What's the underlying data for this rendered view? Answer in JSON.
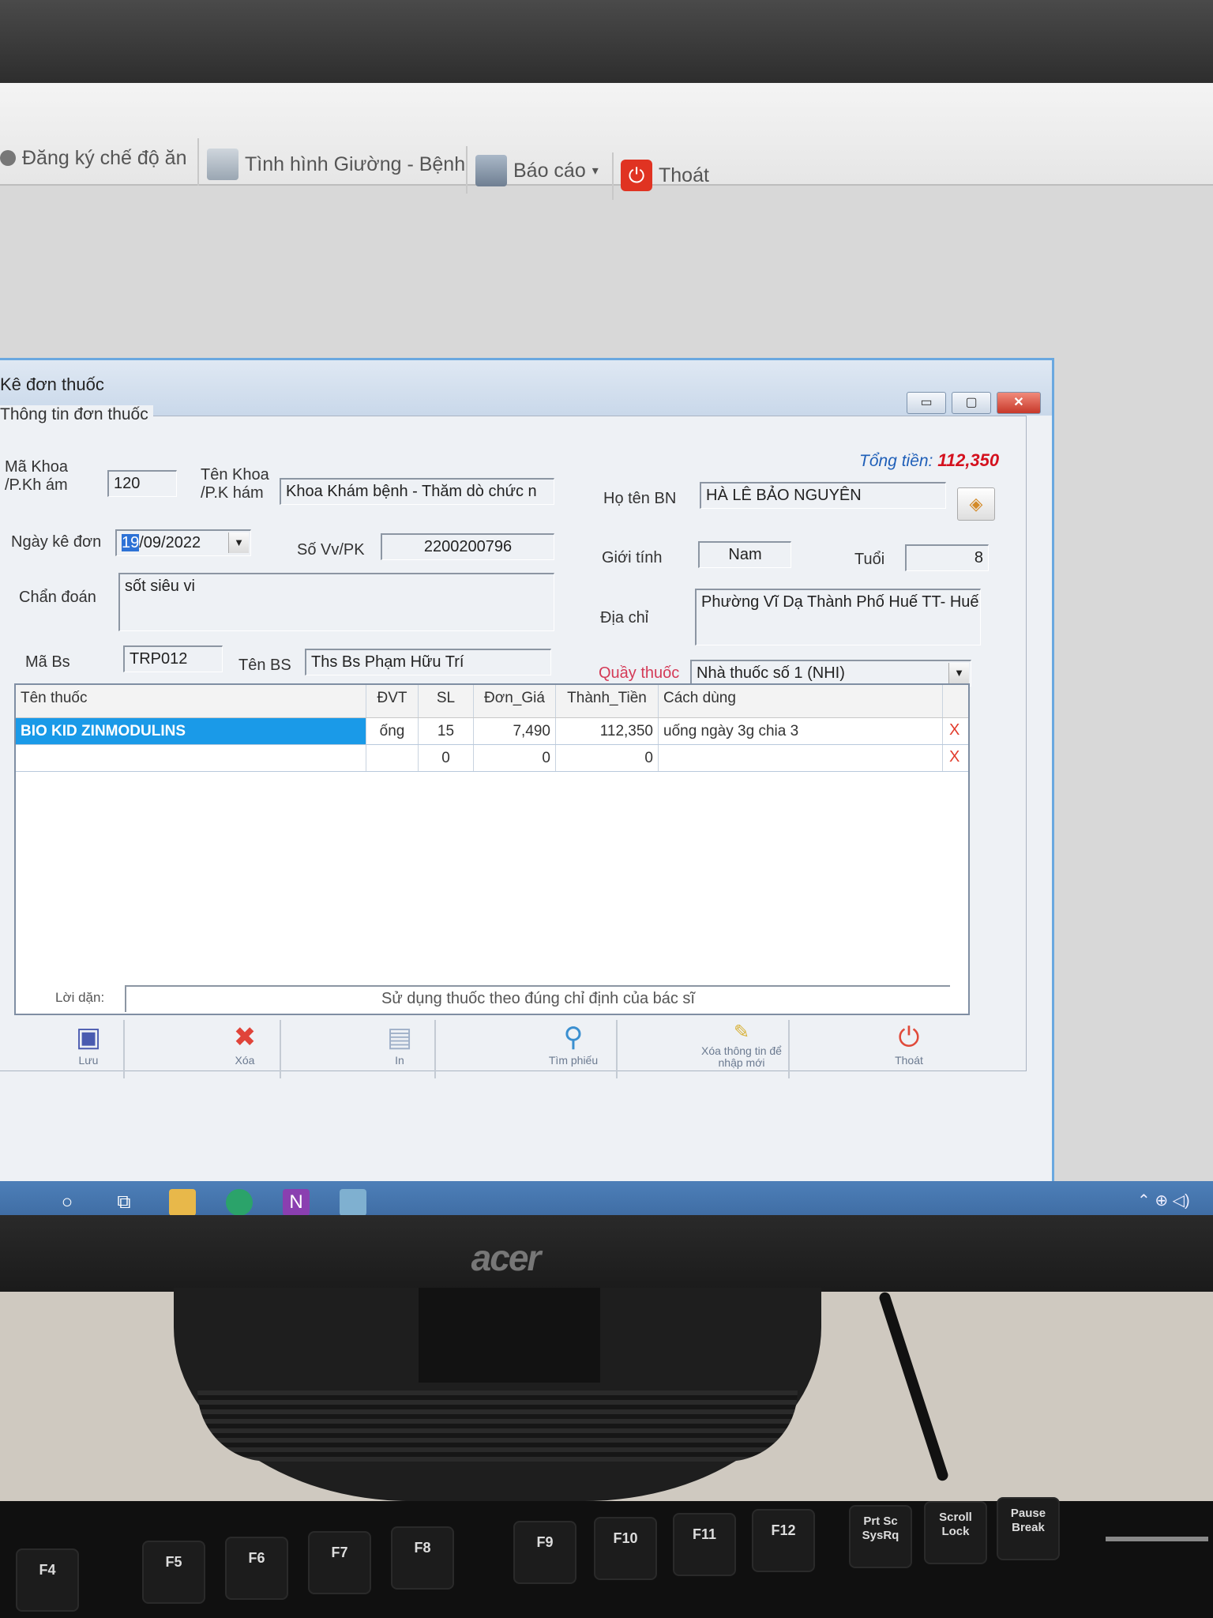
{
  "toolbar": {
    "diet_label": "Đăng ký chế độ ăn",
    "beds_label": "Tình hình Giường - Bệnh",
    "report_label": "Báo cáo",
    "report_dropdown": "▾",
    "exit_label": "Thoát"
  },
  "dialog": {
    "title": "Kê đơn thuốc",
    "min": "▭",
    "max": "▢",
    "close": "✕"
  },
  "group": {
    "legend": "Thông tin đơn thuốc",
    "total_label": "Tổng tiền:",
    "total_value": "112,350"
  },
  "form": {
    "ma_khoa_label": "Mã Khoa /P.Kh ám",
    "ma_khoa_value": "120",
    "ten_khoa_label": "Tên Khoa /P.K hám",
    "ten_khoa_value": "Khoa Khám bệnh - Thăm dò chức n",
    "ho_ten_label": "Họ tên BN",
    "ho_ten_value": "HÀ LÊ BẢO NGUYÊN",
    "ngay_label": "Ngày kê đơn",
    "ngay_day": "19",
    "ngay_rest": "/09/2022",
    "so_vv_label": "Số Vv/PK",
    "so_vv_value": "2200200796",
    "gioi_tinh_label": "Giới tính",
    "gioi_tinh_value": "Nam",
    "tuoi_label": "Tuổi",
    "tuoi_value": "8",
    "chan_doan_label": "Chẩn đoán",
    "chan_doan_value": "sốt siêu vi",
    "dia_chi_label": "Địa chỉ",
    "dia_chi_value": "Phường Vĩ Dạ Thành Phố Huế TT- Huế",
    "ma_bs_label": "Mã Bs",
    "ma_bs_value": "TRP012",
    "ten_bs_label": "Tên BS",
    "ten_bs_value": "Ths Bs Phạm Hữu Trí",
    "quay_label": "Quầy thuốc",
    "quay_value": "Nhà thuốc số 1 (NHI)",
    "diamond": "◈"
  },
  "grid": {
    "headers": [
      "Tên thuốc",
      "ĐVT",
      "SL",
      "Đơn_Giá",
      "Thành_Tiền",
      "Cách dùng"
    ],
    "rows": [
      [
        "BIO KID ZINMODULINS",
        "ống",
        "15",
        "7,490",
        "112,350",
        "uống ngày 3g chia 3",
        "X"
      ],
      [
        "",
        "",
        "0",
        "0",
        "0",
        "",
        "X"
      ]
    ]
  },
  "note": {
    "label": "Lời dặn:",
    "value": "Sử dụng thuốc theo đúng chỉ định của bác sĩ"
  },
  "actions": {
    "save": "Lưu",
    "delete": "Xóa",
    "print": "In",
    "find": "Tìm phiếu",
    "clear": "Xóa thông tin để nhập mới",
    "exit": "Thoát"
  },
  "taskbar": {
    "tray": "⌃ ⊕ ◁)"
  },
  "monitor": {
    "brand": "acer"
  },
  "keyboard": {
    "keys": [
      "F4",
      "F5",
      "F6",
      "F7",
      "F8",
      "F9",
      "F10",
      "F11",
      "F12",
      "Prt Sc SysRq",
      "Scroll Lock",
      "Pause Break"
    ]
  },
  "colors": {
    "dialog_border": "#6aa8e0",
    "total_value": "#d4111e",
    "selected_row": "#1a9ae8",
    "taskbar": "#4d7fb8"
  }
}
